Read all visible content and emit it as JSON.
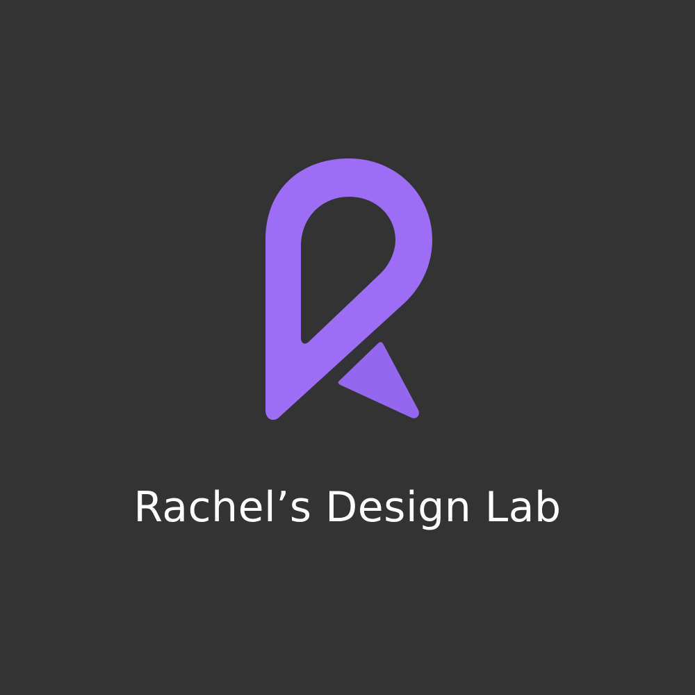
{
  "brand": {
    "name": "Rachel’s Design Lab",
    "logo_icon": "r-letter-logo-icon"
  },
  "colors": {
    "background": "#333333",
    "accent": "#9E6DF5",
    "accent_dark": "#9468EE",
    "text": "#FFFFFF"
  }
}
